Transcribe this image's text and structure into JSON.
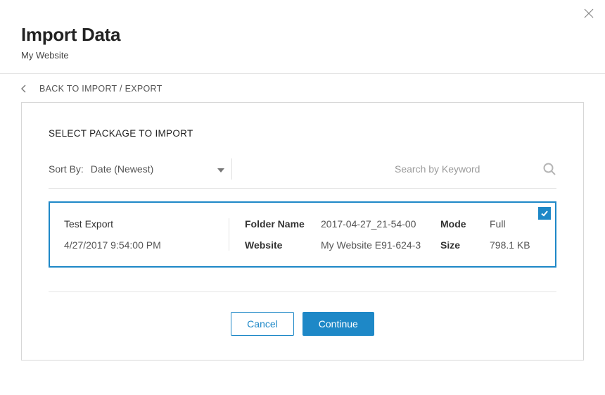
{
  "header": {
    "title": "Import Data",
    "subtitle": "My Website"
  },
  "back_label": "BACK TO IMPORT / EXPORT",
  "panel": {
    "title": "SELECT PACKAGE TO IMPORT",
    "sort_label": "Sort By:",
    "sort_value": "Date (Newest)",
    "search_placeholder": "Search by Keyword"
  },
  "package": {
    "name": "Test Export",
    "timestamp": "4/27/2017 9:54:00 PM",
    "folder_label": "Folder Name",
    "folder_value": "2017-04-27_21-54-00",
    "website_label": "Website",
    "website_value": "My Website E91-624-3",
    "mode_label": "Mode",
    "mode_value": "Full",
    "size_label": "Size",
    "size_value": "798.1 KB",
    "selected": true
  },
  "buttons": {
    "cancel": "Cancel",
    "continue": "Continue"
  }
}
